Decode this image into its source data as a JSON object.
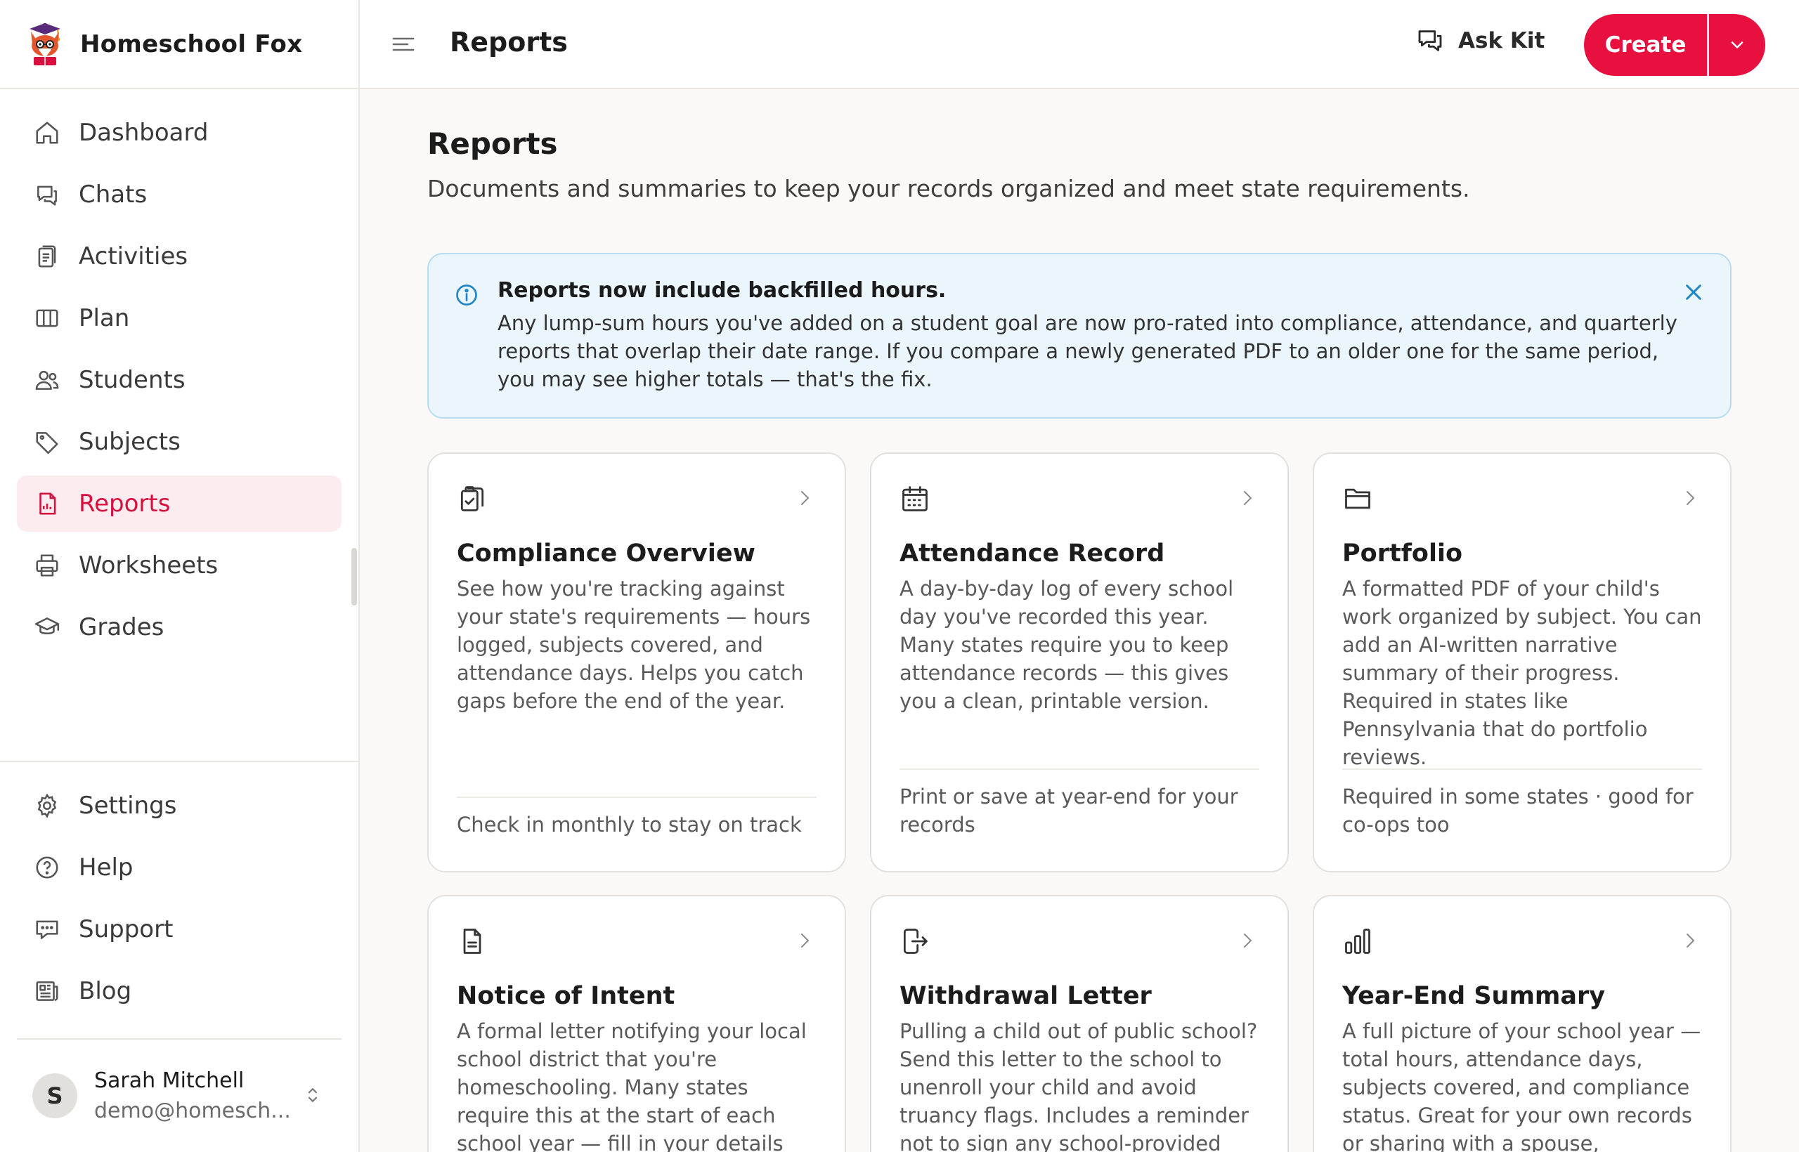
{
  "app": {
    "name": "Homeschool Fox"
  },
  "sidebar": {
    "items": [
      {
        "label": "Dashboard",
        "icon": "home-icon"
      },
      {
        "label": "Chats",
        "icon": "chat-icon"
      },
      {
        "label": "Activities",
        "icon": "clipboard-icon"
      },
      {
        "label": "Plan",
        "icon": "columns-icon"
      },
      {
        "label": "Students",
        "icon": "users-icon"
      },
      {
        "label": "Subjects",
        "icon": "tag-icon"
      },
      {
        "label": "Reports",
        "icon": "document-icon",
        "active": true
      },
      {
        "label": "Worksheets",
        "icon": "printer-icon"
      },
      {
        "label": "Grades",
        "icon": "graduation-cap-icon"
      }
    ],
    "bottom_items": [
      {
        "label": "Settings",
        "icon": "gear-icon"
      },
      {
        "label": "Help",
        "icon": "help-circle-icon"
      },
      {
        "label": "Support",
        "icon": "message-icon"
      },
      {
        "label": "Blog",
        "icon": "newspaper-icon"
      }
    ],
    "user": {
      "initial": "S",
      "name": "Sarah Mitchell",
      "email": "demo@homesch..."
    }
  },
  "header": {
    "title": "Reports",
    "ask_kit_label": "Ask Kit",
    "create_label": "Create"
  },
  "main": {
    "title": "Reports",
    "subtitle": "Documents and summaries to keep your records organized and meet state requirements.",
    "notice": {
      "title": "Reports now include backfilled hours.",
      "body": "Any lump-sum hours you've added on a student goal are now pro-rated into compliance, attendance, and quarterly reports that overlap their date range. If you compare a newly generated PDF to an older one for the same period, you may see higher totals — that's the fix."
    },
    "cards": [
      {
        "title": "Compliance Overview",
        "icon": "clipboard-check-icon",
        "description": "See how you're tracking against your state's requirements — hours logged, subjects covered, and attendance days. Helps you catch gaps before the end of the year.",
        "footer": "Check in monthly to stay on track"
      },
      {
        "title": "Attendance Record",
        "icon": "calendar-icon",
        "description": "A day-by-day log of every school day you've recorded this year. Many states require you to keep attendance records — this gives you a clean, printable version.",
        "footer": "Print or save at year-end for your records"
      },
      {
        "title": "Portfolio",
        "icon": "folder-icon",
        "description": "A formatted PDF of your child's work organized by subject. You can add an AI-written narrative summary of their progress. Required in states like Pennsylvania that do portfolio reviews.",
        "footer": "Required in some states · good for co-ops too"
      },
      {
        "title": "Notice of Intent",
        "icon": "file-text-icon",
        "description": "A formal letter notifying your local school district that you're homeschooling. Many states require this at the start of each school year — fill in your details and print."
      },
      {
        "title": "Withdrawal Letter",
        "icon": "file-export-icon",
        "description": "Pulling a child out of public school? Send this letter to the school to unenroll your child and avoid truancy flags. Includes a reminder not to sign any school-provided"
      },
      {
        "title": "Year-End Summary",
        "icon": "bar-chart-icon",
        "description": "A full picture of your school year — total hours, attendance days, subjects covered, and compliance status. Great for your own records or sharing with a spouse, evaluator,"
      }
    ]
  },
  "colors": {
    "accent": "#e8103f",
    "active_nav_bg": "#fdecef",
    "info_bg": "#eaf5fc",
    "info_border": "#b8dcf2",
    "info_icon": "#1f86c7"
  }
}
